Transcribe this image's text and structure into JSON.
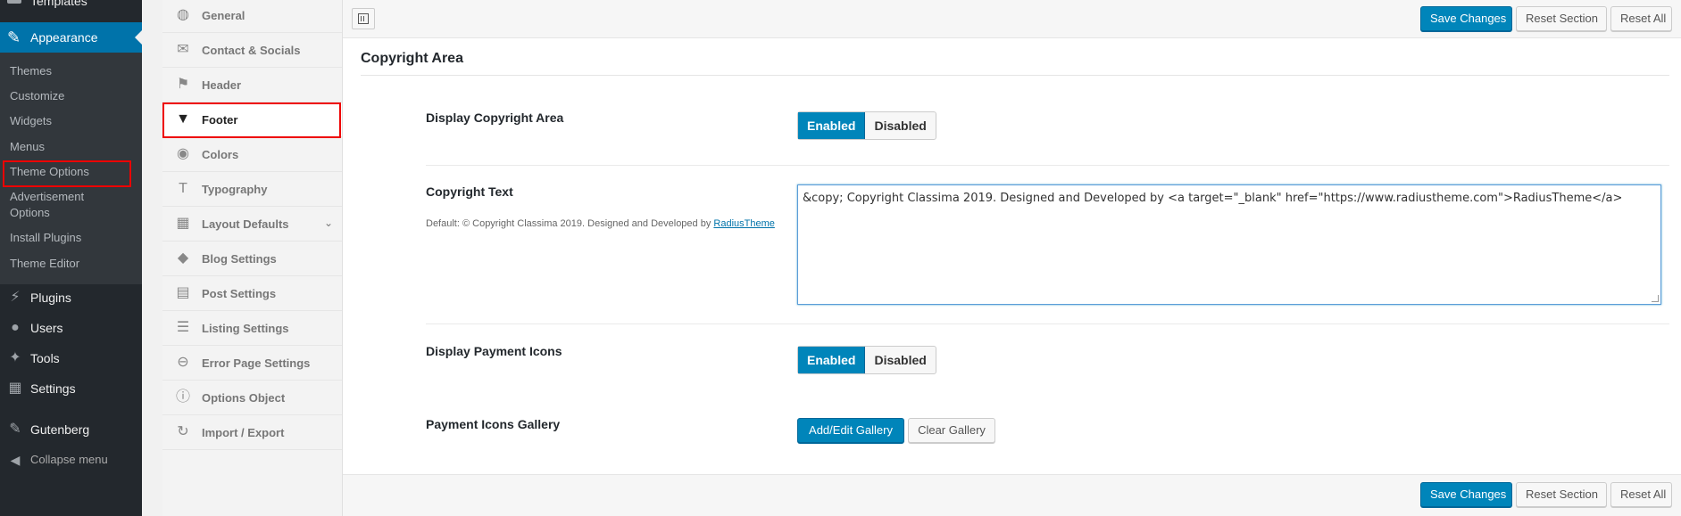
{
  "wp_sidebar": {
    "prev_item": "Templates",
    "appearance": "Appearance",
    "submenu": [
      "Themes",
      "Customize",
      "Widgets",
      "Menus",
      "Theme Options",
      "Advertisement",
      "Options",
      "Install Plugins",
      "Theme Editor"
    ],
    "menus": [
      "Plugins",
      "Users",
      "Tools",
      "Settings",
      "Gutenberg"
    ],
    "collapse": "Collapse menu"
  },
  "redux_sidebar": {
    "items": [
      "General",
      "Contact & Socials",
      "Header",
      "Footer",
      "Colors",
      "Typography",
      "Layout Defaults",
      "Blog Settings",
      "Post Settings",
      "Listing Settings",
      "Error Page Settings",
      "Options Object",
      "Import / Export"
    ],
    "active": "Footer"
  },
  "toolbar": {
    "save_label": "Save Changes",
    "reset_section_label": "Reset Section",
    "reset_all_label": "Reset All"
  },
  "section": {
    "title": "Copyright Area"
  },
  "fields": {
    "display_copyright": {
      "label": "Display Copyright Area",
      "enabled": "Enabled",
      "disabled": "Disabled"
    },
    "copyright_text": {
      "label": "Copyright Text",
      "default_prefix": "Default: © Copyright Classima 2019. Designed and Developed by ",
      "default_link": "RadiusTheme",
      "value": "&copy; Copyright Classima 2019. Designed and Developed by <a target=\"_blank\" href=\"https://www.radiustheme.com\">RadiusTheme</a>"
    },
    "display_payment": {
      "label": "Display Payment Icons",
      "enabled": "Enabled",
      "disabled": "Disabled"
    },
    "payment_gallery": {
      "label": "Payment Icons Gallery",
      "add_label": "Add/Edit Gallery",
      "clear_label": "Clear Gallery"
    }
  },
  "colors": {
    "wp_blue": "#0073aa",
    "button_blue": "#0085ba",
    "sidebar_dark": "#23282d",
    "highlight_red": "#e00000"
  }
}
